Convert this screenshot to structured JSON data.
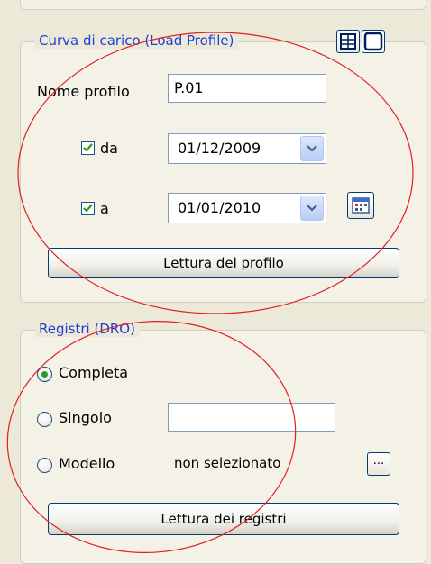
{
  "load_profile": {
    "title": "Curva di carico (Load Profile)",
    "profile_name_label": "Nome profilo",
    "profile_name_value": "P.01",
    "from_label": "da",
    "from_checked": true,
    "from_date": "01/12/2009",
    "to_label": "a",
    "to_checked": true,
    "to_date": "01/01/2010",
    "read_button": "Lettura del profilo",
    "icons": [
      "grid-view-icon",
      "single-view-icon",
      "calendar-icon"
    ]
  },
  "registers": {
    "title": "Registri (DRO)",
    "options": [
      {
        "label": "Completa",
        "selected": true
      },
      {
        "label": "Singolo",
        "selected": false
      },
      {
        "label": "Modello",
        "selected": false
      }
    ],
    "single_value": "",
    "model_value": "non selezionato",
    "browse_button": "...",
    "read_button": "Lettura dei registri"
  },
  "colors": {
    "group_title": "#1f3fd4",
    "annotation_ellipse": "#e02020",
    "check_mark": "#21a121",
    "radio_dot": "#2a9a2a"
  }
}
